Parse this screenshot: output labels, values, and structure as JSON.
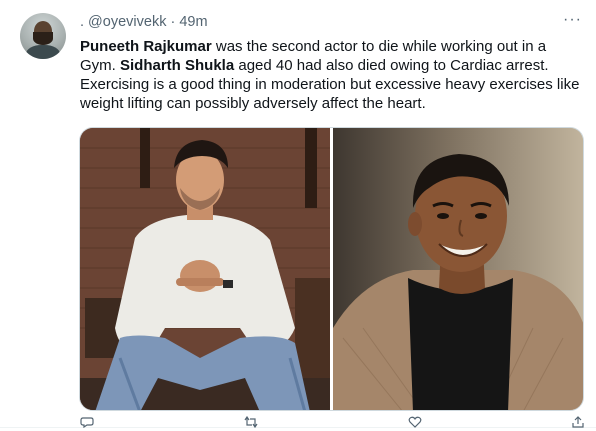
{
  "tweet": {
    "handle": ". @oyevivekk",
    "separator": "·",
    "time": "49m",
    "more": "···",
    "text_parts": [
      {
        "bold": true,
        "text": "Puneeth Rajkumar"
      },
      {
        "bold": false,
        "text": " was the second actor to die while working out in a Gym. "
      },
      {
        "bold": true,
        "text": "Sidharth Shukla"
      },
      {
        "bold": false,
        "text": " aged 40 had also died owing to Cardiac arrest. Exercising is a good thing in moderation but excessive heavy exercises like weight lifting can possibly adversely affect the heart."
      }
    ],
    "colors": {
      "text": "#0f1419",
      "muted": "#536471",
      "border": "#cfd9de"
    },
    "media": [
      {
        "icon": "photo-sidharth-shukla"
      },
      {
        "icon": "photo-puneeth-rajkumar"
      }
    ],
    "actions": [
      {
        "icon": "reply-icon"
      },
      {
        "icon": "retweet-icon"
      },
      {
        "icon": "like-icon"
      },
      {
        "icon": "share-icon"
      }
    ]
  }
}
